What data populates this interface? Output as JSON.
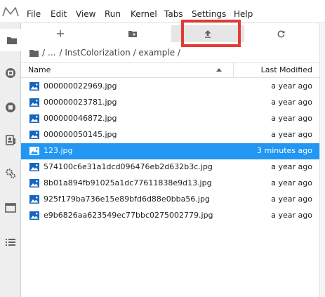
{
  "menubar": {
    "items": [
      "File",
      "Edit",
      "View",
      "Run",
      "Kernel",
      "Tabs",
      "Settings",
      "Help"
    ]
  },
  "toolbar": {
    "buttons": [
      "plus-icon",
      "new-folder-icon",
      "upload-icon",
      "refresh-icon"
    ]
  },
  "breadcrumbs": {
    "root_sep": "/",
    "ellipsis": "...",
    "path": "/ InstColorization / example /"
  },
  "file_list": {
    "col_name": "Name",
    "col_modified": "Last Modified",
    "rows": [
      {
        "name": "000000022969.jpg",
        "modified": "a year ago",
        "selected": false
      },
      {
        "name": "000000023781.jpg",
        "modified": "a year ago",
        "selected": false
      },
      {
        "name": "000000046872.jpg",
        "modified": "a year ago",
        "selected": false
      },
      {
        "name": "000000050145.jpg",
        "modified": "a year ago",
        "selected": false
      },
      {
        "name": "123.jpg",
        "modified": "3 minutes ago",
        "selected": true
      },
      {
        "name": "574100c6e31a1dcd096476eb2d632b3c.jpg",
        "modified": "a year ago",
        "selected": false
      },
      {
        "name": "8b01a894fb91025a1dc77611838e9d13.jpg",
        "modified": "a year ago",
        "selected": false
      },
      {
        "name": "925f179ba736e15e89bfd6d88e0bba56.jpg",
        "modified": "a year ago",
        "selected": false
      },
      {
        "name": "e9b6826aa623549ec77bbc0275002779.jpg",
        "modified": "a year ago",
        "selected": false
      }
    ]
  },
  "leftbar": {
    "tabs": [
      "folder-icon",
      "running-icon",
      "stop-icon",
      "commands-icon",
      "settings-icon",
      "tabs-icon",
      "toc-icon"
    ]
  },
  "colors": {
    "selection": "#2196f3",
    "highlight_box": "#e53935",
    "image_icon": "#1565c0"
  }
}
